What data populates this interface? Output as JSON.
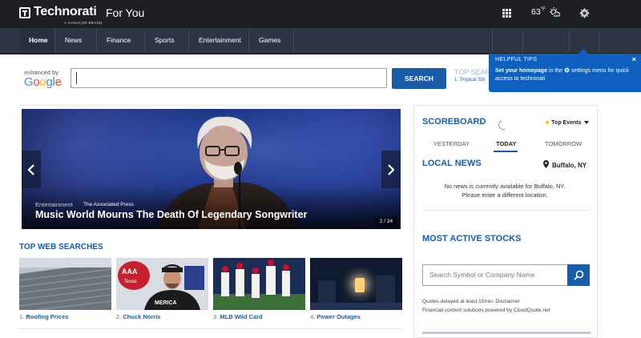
{
  "header": {
    "logo_text": "Technorati",
    "logo_sub": "A SYNACOR BRAND",
    "section_title": "For You"
  },
  "nav": {
    "items": [
      {
        "label": "Home",
        "active": true,
        "has_dropdown": false
      },
      {
        "label": "News",
        "has_dropdown": true
      },
      {
        "label": "Finance",
        "has_dropdown": true
      },
      {
        "label": "Sports",
        "has_dropdown": true
      },
      {
        "label": "Entertainment",
        "has_dropdown": false
      },
      {
        "label": "Games",
        "has_dropdown": true
      }
    ],
    "apps_icon": "grid-icon",
    "temperature": "63",
    "temperature_unit": "°F",
    "weather_icon": "partly-cloudy-icon",
    "settings_icon": "gear-icon"
  },
  "search": {
    "enhanced_by": "enhanced by",
    "provider": "Google",
    "value": "",
    "button_label": "SEARCH",
    "top_searches_label": "TOP SEAR",
    "top_search_first": "1. Tropical Sto"
  },
  "tips": {
    "title": "HELPFUL TIPS",
    "bold_text": "Set your homepage",
    "text_before_icon": " in the ",
    "text_after_icon": " settings menu for quick access to technorati",
    "close_label": "×"
  },
  "hero": {
    "category": "Entertainment",
    "source": "The Associated Press",
    "title": "Music World Mourns The Death Of Legendary Songwriter",
    "counter": "2 / 24"
  },
  "top_web_searches": {
    "title": "TOP WEB SEARCHES",
    "items": [
      {
        "num": "1.",
        "label": "Roofing Prices"
      },
      {
        "num": "2.",
        "label": "Chuck Norris"
      },
      {
        "num": "3.",
        "label": "MLB Wild Card"
      },
      {
        "num": "4.",
        "label": "Power Outages"
      }
    ]
  },
  "scoreboard": {
    "title": "SCOREBOARD",
    "filter_label": "Top Events",
    "tabs": [
      "YESTERDAY",
      "TODAY",
      "TOMORROW"
    ],
    "active_tab": "TODAY"
  },
  "local_news": {
    "title": "LOCAL NEWS",
    "location": "Buffalo, NY",
    "message_line1": "No news is currently available for Buffalo, NY.",
    "message_line2": "Please enter a different location."
  },
  "stocks": {
    "title": "MOST ACTIVE STOCKS",
    "placeholder": "Search Symbol or Company Name",
    "note_line1": "Quotes delayed at least 15min. Disclaimer",
    "note_line2": "Financial content solutions powered by CloudQuote.net"
  },
  "colors": {
    "brand_blue": "#1a5ca8",
    "nav_bg": "#2e3643",
    "header_bg": "#1d1f24",
    "tips_bg": "#0e5fc0"
  }
}
